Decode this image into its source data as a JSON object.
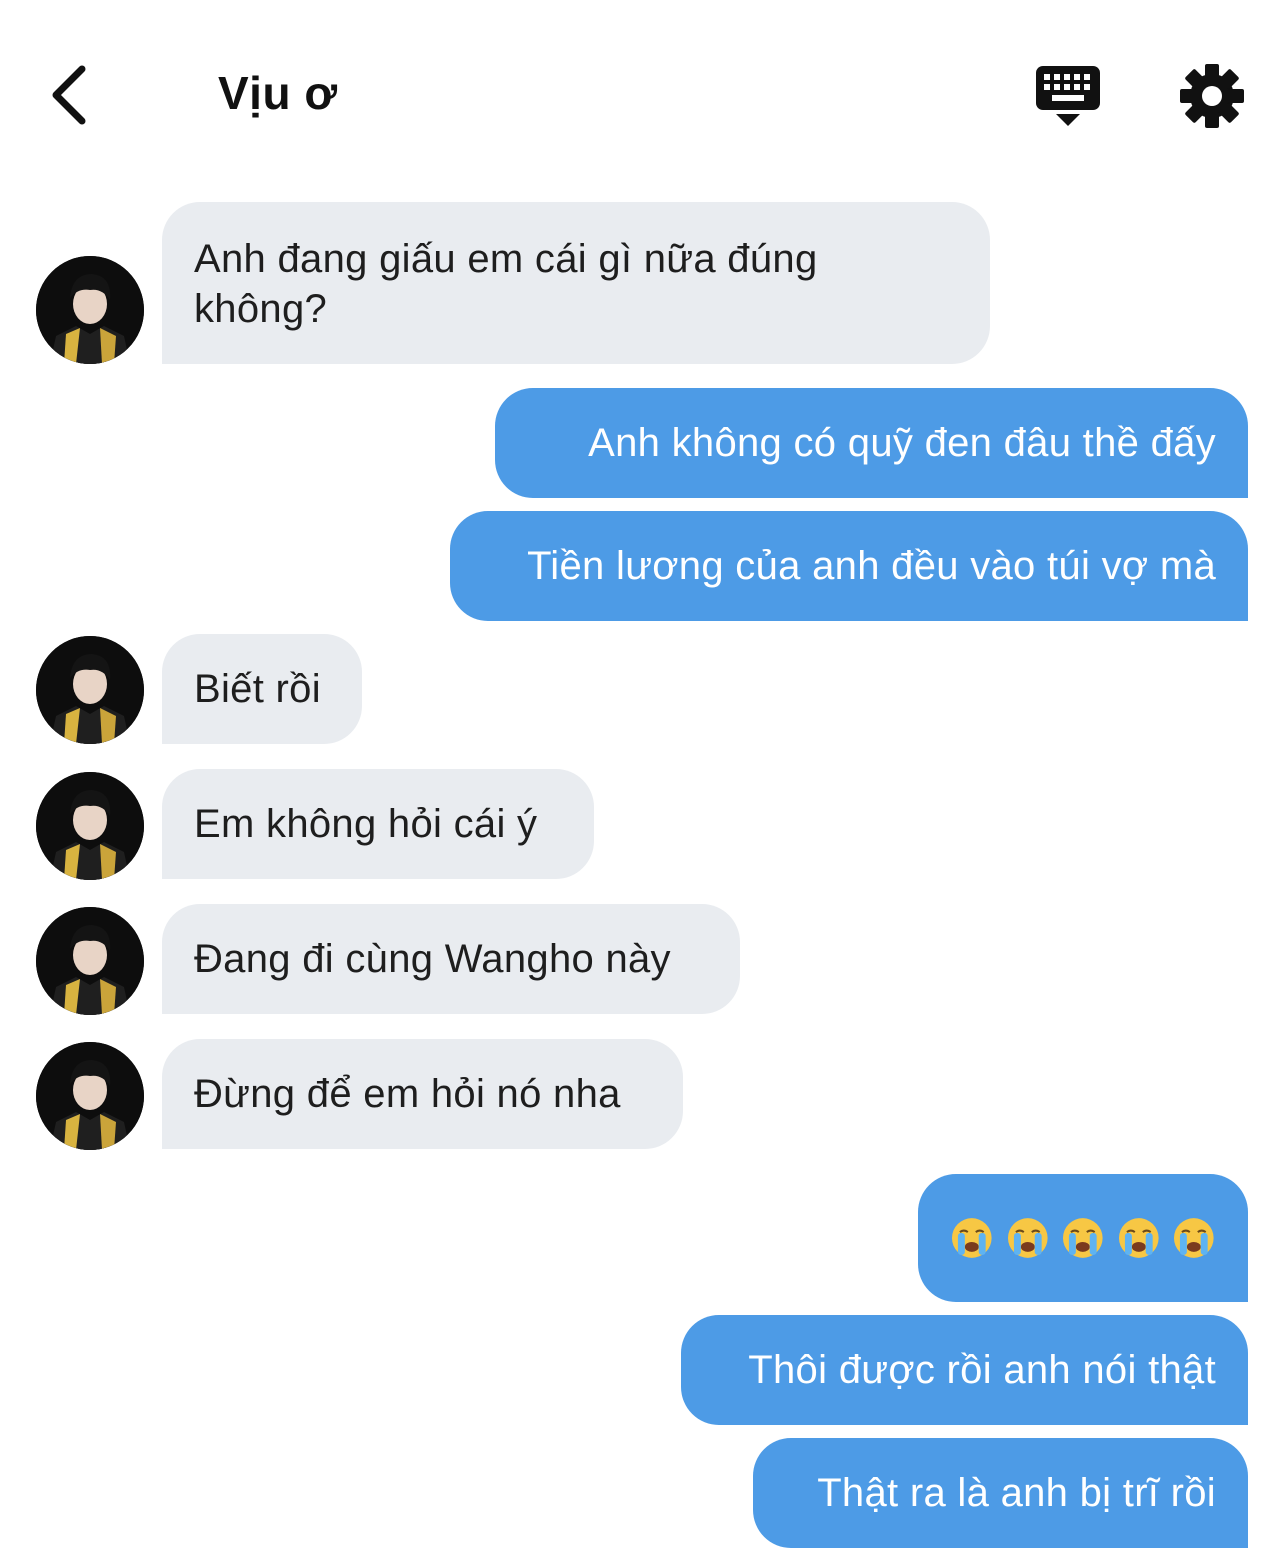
{
  "header": {
    "title": "Vịu ơ"
  },
  "messages": {
    "m1": "Anh đang giấu em cái gì nữa đúng không?",
    "m1_line1": "Anh đang giấu em cái gì nữa đúng",
    "m1_line2": "không?",
    "m2": "Anh không có quỹ đen đâu thề đấy",
    "m3": "Tiền lương của anh đều vào túi vợ mà",
    "m4": "Biết rồi",
    "m5": "Em không hỏi cái ý",
    "m6": "Đang đi cùng Wangho này",
    "m7": "Đừng để em hỏi nó nha",
    "m8_emoji_count": 5,
    "m9": "Thôi được rồi anh nói thật",
    "m10": "Thật ra là anh bị trĩ rồi"
  },
  "icons": {
    "back": "chevron-left-icon",
    "keyboard": "keyboard-icon",
    "settings": "gear-icon",
    "emoji": "loudly-crying-face-emoji"
  },
  "colors": {
    "incoming_bubble": "#e9ecf0",
    "outgoing_bubble": "#4d9be6"
  }
}
